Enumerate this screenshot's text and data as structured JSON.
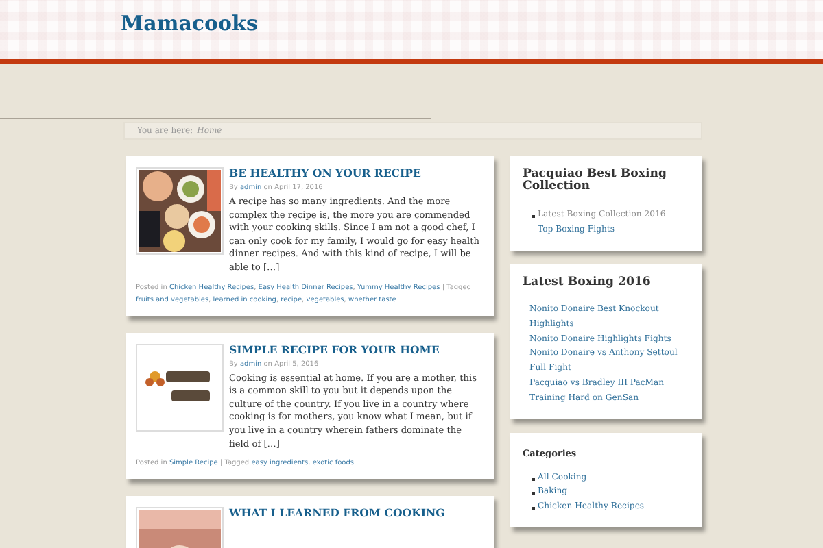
{
  "site": {
    "title": "Mamacooks"
  },
  "breadcrumb": {
    "label": "You are here:",
    "current": "Home"
  },
  "posts": [
    {
      "title": "BE HEALTHY ON YOUR RECIPE",
      "by": "By",
      "author": "admin",
      "date": "on April 17, 2016",
      "excerpt": "A recipe has so many ingredients. And the more complex the recipe is, the more you are commended with your cooking skills. Since I am not a good chef, I can only cook for my family, I would go for easy health dinner recipes. And with this kind of recipe, I will be able to […]",
      "posted_label": "Posted in",
      "categories": [
        "Chicken Healthy Recipes",
        "Easy Health Dinner Recipes",
        "Yummy Healthy Recipes"
      ],
      "tagged_label": "| Tagged",
      "tags": [
        "fruits and vegetables",
        "learned in cooking",
        "recipe",
        "vegetables",
        "whether taste"
      ]
    },
    {
      "title": "SIMPLE RECIPE FOR YOUR HOME",
      "by": "By",
      "author": "admin",
      "date": "on April 5, 2016",
      "excerpt": "Cooking is essential at home. If you are a mother, this is a common skill to you but it depends upon the culture of the country. If you live in a country where cooking is for mothers, you know what I mean, but if you live in a country wherein fathers dominate the field of […]",
      "posted_label": "Posted in",
      "categories": [
        "Simple Recipe"
      ],
      "tagged_label": "| Tagged",
      "tags": [
        "easy ingredients",
        "exotic foods"
      ]
    },
    {
      "title": "WHAT I LEARNED FROM COOKING"
    }
  ],
  "list_separator": ",",
  "widgets": [
    {
      "title": "Pacquiao Best Boxing Collection",
      "kind": "bulleted",
      "small_title": false,
      "items": [
        {
          "label": "Latest Boxing Collection 2016",
          "link": false,
          "children": [
            {
              "label": "Top Boxing Fights",
              "link": true
            }
          ]
        }
      ]
    },
    {
      "title": "Latest Boxing 2016",
      "kind": "plain",
      "small_title": false,
      "items": [
        {
          "label": "Nonito Donaire Best Knockout Highlights",
          "link": true
        },
        {
          "label": "Nonito Donaire Highlights Fights",
          "link": true
        },
        {
          "label": "Nonito Donaire vs Anthony Settoul Full Fight",
          "link": true
        },
        {
          "label": "Pacquiao vs Bradley III PacMan Training Hard on GenSan",
          "link": true
        }
      ]
    },
    {
      "title": "Categories",
      "kind": "bulleted",
      "small_title": true,
      "items": [
        {
          "label": "All Cooking",
          "link": true
        },
        {
          "label": "Baking",
          "link": true
        },
        {
          "label": "Chicken Healthy Recipes",
          "link": true
        }
      ]
    }
  ]
}
